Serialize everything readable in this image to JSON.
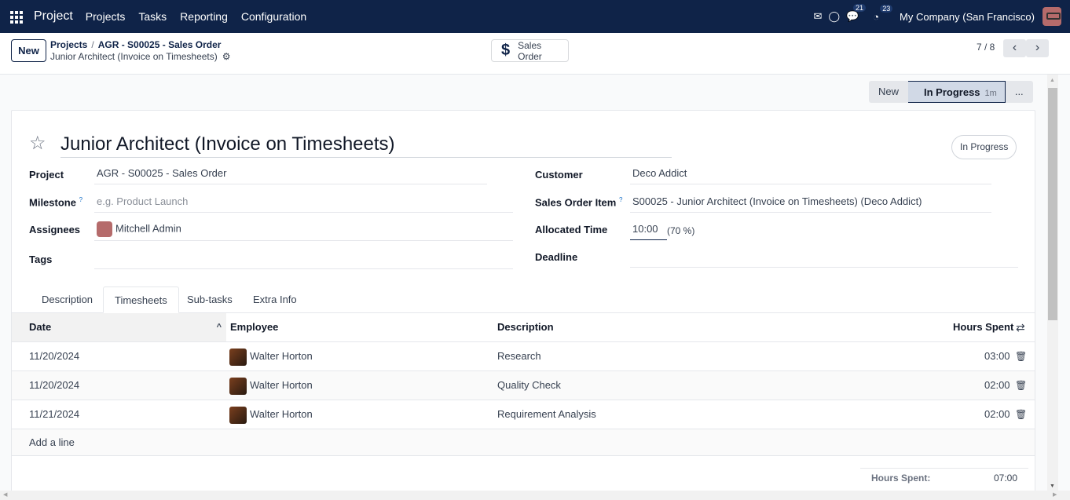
{
  "navbar": {
    "app_name": "Project",
    "menu": [
      "Projects",
      "Tasks",
      "Reporting",
      "Configuration"
    ],
    "messages_badge": "21",
    "activities_badge": "23",
    "company": "My Company (San Francisco)"
  },
  "control": {
    "new_label": "New",
    "breadcrumb": [
      "Projects",
      "AGR - S00025 - Sales Order"
    ],
    "current": "Junior Architect (Invoice on Timesheets)",
    "smart_button": "Sales Order",
    "pager": "7 / 8"
  },
  "statusbar": {
    "stages": [
      "New",
      "In Progress",
      "..."
    ],
    "active_duration": "1m"
  },
  "form": {
    "title": "Junior Architect (Invoice on Timesheets)",
    "state": "In Progress",
    "left": {
      "project_label": "Project",
      "project_value": "AGR - S00025 - Sales Order",
      "milestone_label": "Milestone",
      "milestone_placeholder": "e.g. Product Launch",
      "assignees_label": "Assignees",
      "assignee": "Mitchell Admin",
      "tags_label": "Tags"
    },
    "right": {
      "customer_label": "Customer",
      "customer_value": "Deco Addict",
      "soi_label": "Sales Order Item",
      "soi_value": "S00025 - Junior Architect (Invoice on Timesheets) (Deco Addict)",
      "allocated_label": "Allocated Time",
      "allocated_value": "10:00",
      "allocated_percent": "(70 %)",
      "deadline_label": "Deadline"
    },
    "help_mark": "?"
  },
  "tabs": [
    "Description",
    "Timesheets",
    "Sub-tasks",
    "Extra Info"
  ],
  "timesheets": {
    "columns": [
      "Date",
      "Employee",
      "Description",
      "Hours Spent"
    ],
    "rows": [
      {
        "date": "11/20/2024",
        "employee": "Walter Horton",
        "description": "Research",
        "hours": "03:00"
      },
      {
        "date": "11/20/2024",
        "employee": "Walter Horton",
        "description": "Quality Check",
        "hours": "02:00"
      },
      {
        "date": "11/21/2024",
        "employee": "Walter Horton",
        "description": "Requirement Analysis",
        "hours": "02:00"
      }
    ],
    "add_line": "Add a line",
    "total_label": "Hours Spent:",
    "total_value": "07:00"
  }
}
